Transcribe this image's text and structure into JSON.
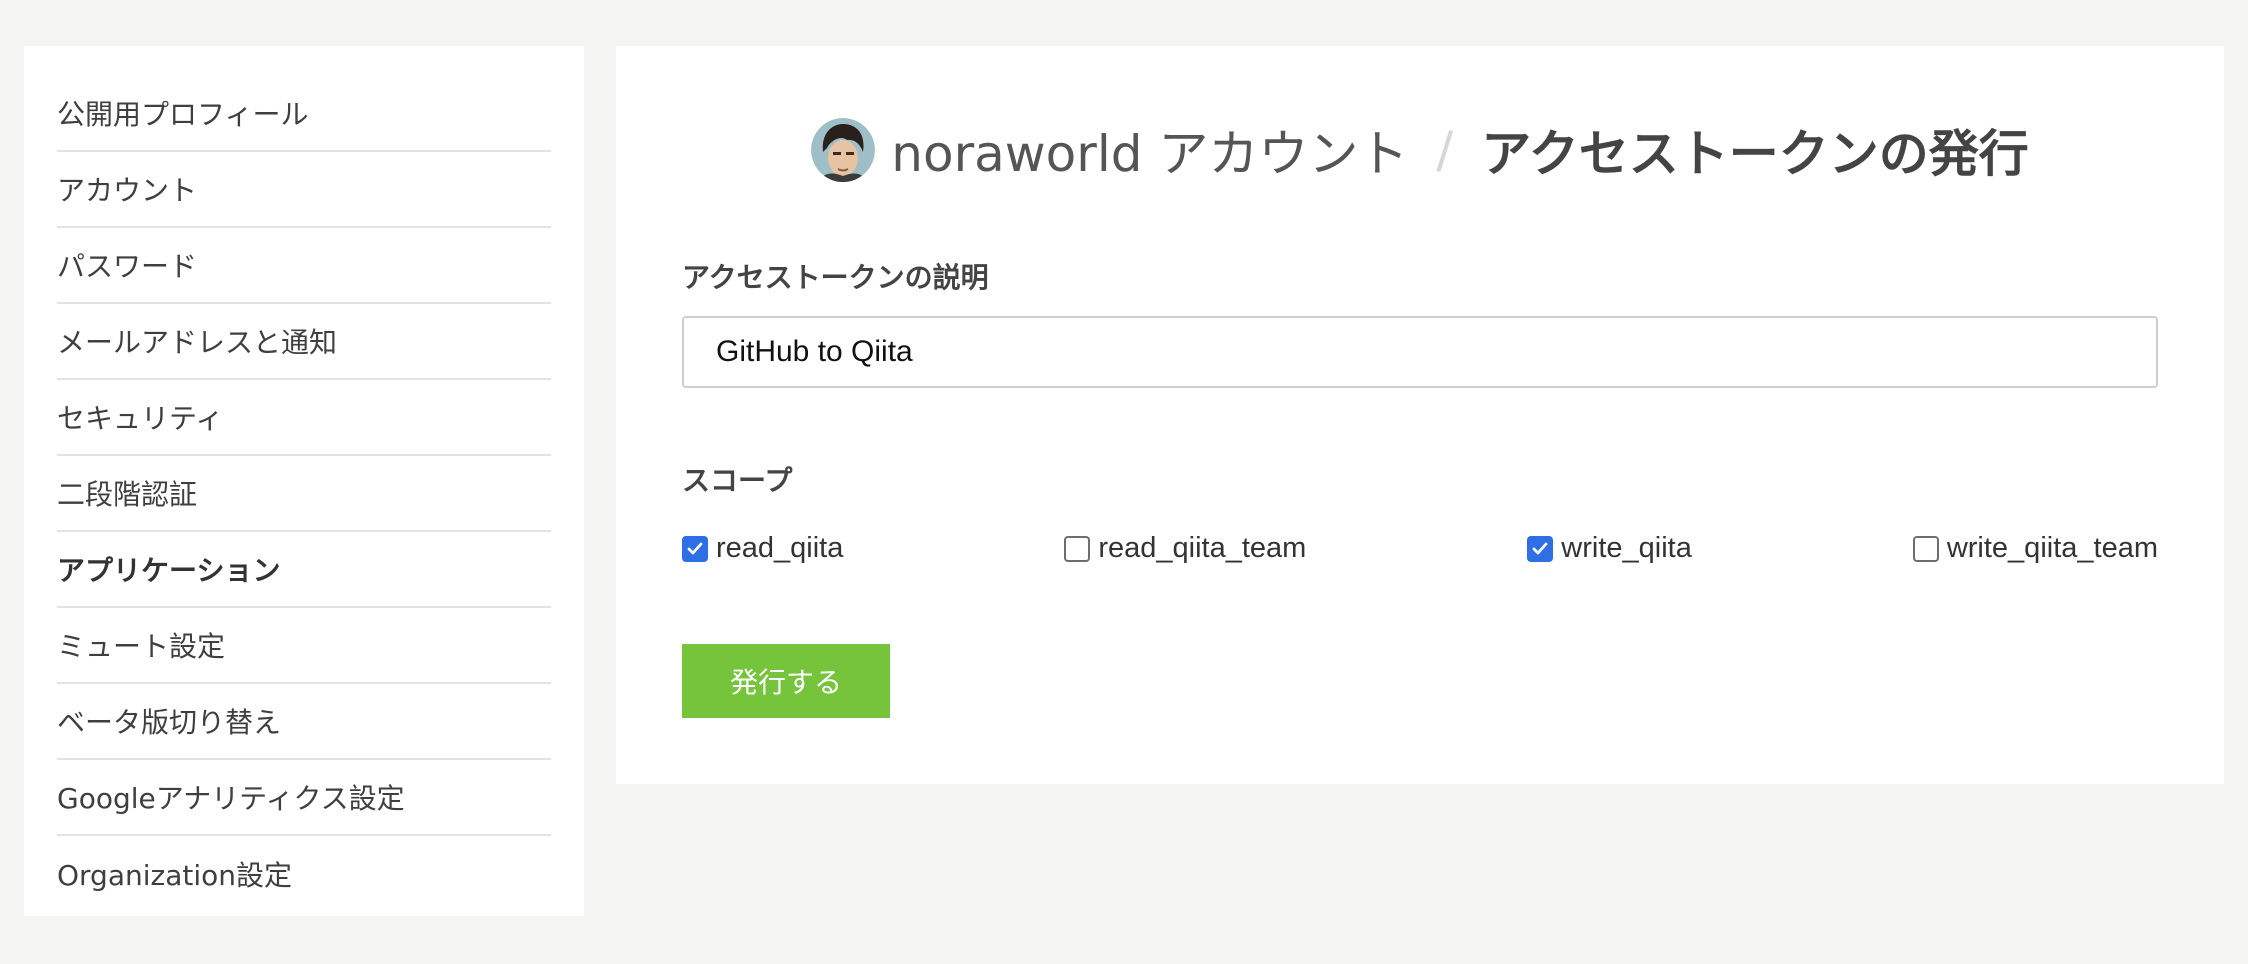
{
  "sidebar": {
    "items": [
      {
        "label": "公開用プロフィール",
        "active": false
      },
      {
        "label": "アカウント",
        "active": false
      },
      {
        "label": "パスワード",
        "active": false
      },
      {
        "label": "メールアドレスと通知",
        "active": false
      },
      {
        "label": "セキュリティ",
        "active": false
      },
      {
        "label": "二段階認証",
        "active": false
      },
      {
        "label": "アプリケーション",
        "active": true
      },
      {
        "label": "ミュート設定",
        "active": false
      },
      {
        "label": "ベータ版切り替え",
        "active": false
      },
      {
        "label": "Googleアナリティクス設定",
        "active": false
      },
      {
        "label": "Organization設定",
        "active": false
      }
    ]
  },
  "header": {
    "account": "noraworld アカウント",
    "separator": "/",
    "page_title": "アクセストークンの発行",
    "avatar_icon": "user-avatar"
  },
  "form": {
    "description_label": "アクセストークンの説明",
    "description_value": "GitHub to Qiita",
    "scope_label": "スコープ",
    "scopes": [
      {
        "label": "read_qiita",
        "checked": true
      },
      {
        "label": "read_qiita_team",
        "checked": false
      },
      {
        "label": "write_qiita",
        "checked": true
      },
      {
        "label": "write_qiita_team",
        "checked": false
      }
    ],
    "submit_label": "発行する"
  },
  "colors": {
    "accent_green": "#76c43b",
    "checkbox_blue": "#2f6fe5",
    "background": "#f5f5f3"
  }
}
